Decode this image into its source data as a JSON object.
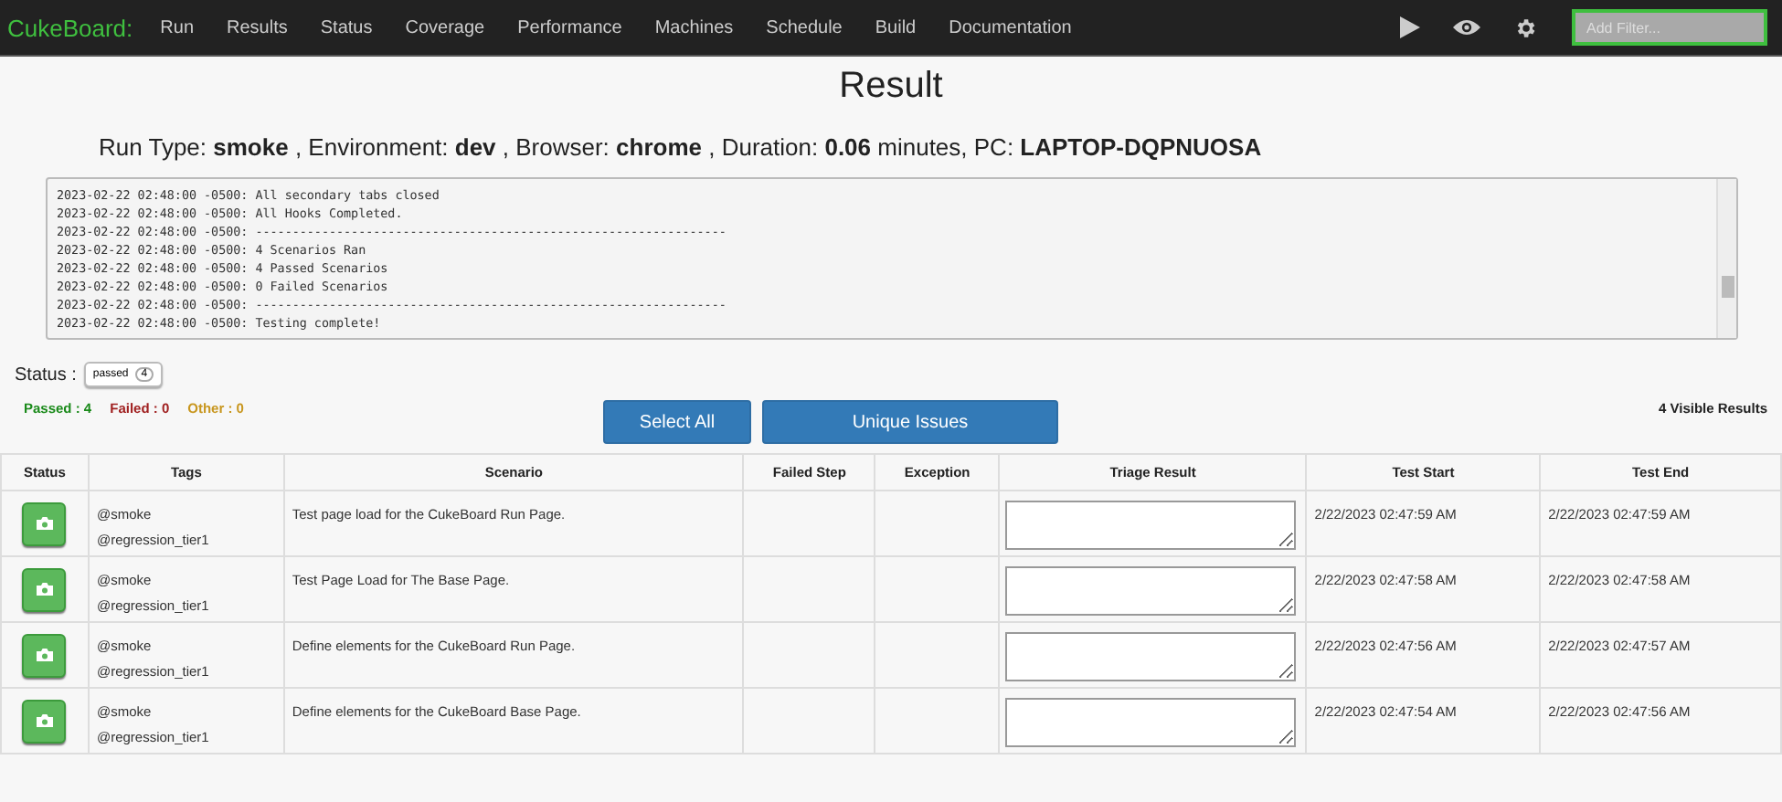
{
  "navbar": {
    "brand": "CukeBoard:",
    "links": [
      "Run",
      "Results",
      "Status",
      "Coverage",
      "Performance",
      "Machines",
      "Schedule",
      "Build",
      "Documentation"
    ],
    "filter": {
      "placeholder": "Add Filter..."
    }
  },
  "title": "Result",
  "run_info": "Run Type: **smoke** , Environment: **dev** , Browser: **chrome** , Duration: **0.06** minutes, PC: **LAPTOP-DQPNUOSA**",
  "log": [
    "2023-02-22 02:48:00 -0500: All secondary tabs closed",
    "2023-02-22 02:48:00 -0500: All Hooks Completed.",
    "2023-02-22 02:48:00 -0500: ----------------------------------------------------------------",
    "2023-02-22 02:48:00 -0500: 4 Scenarios Ran",
    "2023-02-22 02:48:00 -0500: 4 Passed Scenarios",
    "2023-02-22 02:48:00 -0500: 0 Failed Scenarios",
    "2023-02-22 02:48:00 -0500: ----------------------------------------------------------------",
    "2023-02-22 02:48:00 -0500: Testing complete!"
  ],
  "status_filter": {
    "label": "Status :",
    "chip": {
      "label": "passed",
      "count": "4"
    }
  },
  "counts": [
    {
      "text": "Passed : 4",
      "color": "#1a8a1a"
    },
    {
      "text": "Failed : 0",
      "color": "#a02020"
    },
    {
      "text": "Other : 0",
      "color": "#c8961e"
    }
  ],
  "buttons": [
    "Select All",
    "Unique Issues"
  ],
  "visible_results": "4 Visible Results",
  "table": {
    "columns": [
      "Status",
      "Tags",
      "Scenario",
      "Failed Step",
      "Exception",
      "Triage Result",
      "Test Start",
      "Test End"
    ],
    "rows": [
      {
        "kind": "passed",
        "tags": [
          "@smoke",
          "@regression_tier1"
        ],
        "scenario": "Test page load for the CukeBoard Run Page.",
        "start": "2/22/2023 02:47:59 AM",
        "end": "2/22/2023 02:47:59 AM"
      },
      {
        "kind": "passed",
        "tags": [
          "@smoke",
          "@regression_tier1"
        ],
        "scenario": "Test Page Load for The Base Page.",
        "start": "2/22/2023 02:47:58 AM",
        "end": "2/22/2023 02:47:58 AM"
      },
      {
        "kind": "passed",
        "tags": [
          "@smoke",
          "@regression_tier1"
        ],
        "scenario": "Define elements for the CukeBoard Run Page.",
        "start": "2/22/2023 02:47:56 AM",
        "end": "2/22/2023 02:47:57 AM"
      },
      {
        "kind": "passed",
        "tags": [
          "@smoke",
          "@regression_tier1"
        ],
        "scenario": "Define elements for the CukeBoard Base Page.",
        "start": "2/22/2023 02:47:54 AM",
        "end": "2/22/2023 02:47:56 AM"
      }
    ]
  }
}
